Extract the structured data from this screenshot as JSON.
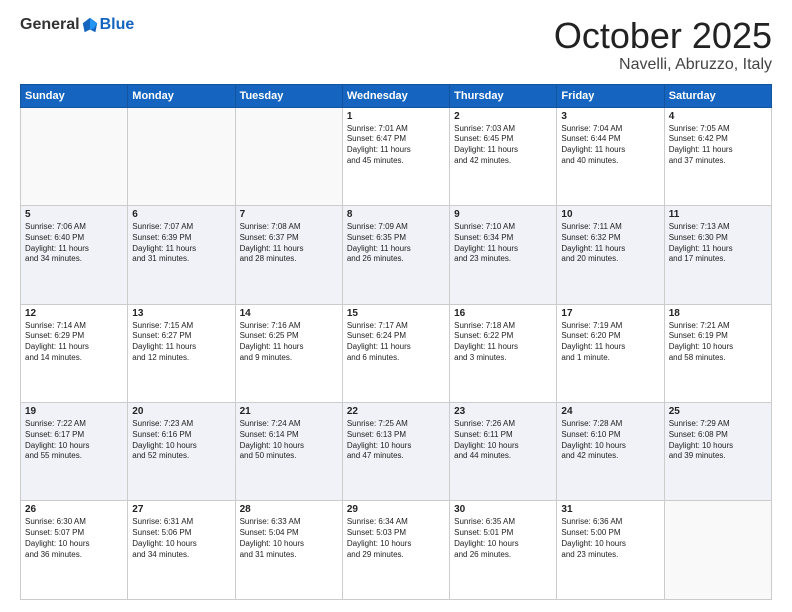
{
  "header": {
    "logo_general": "General",
    "logo_blue": "Blue",
    "title": "October 2025",
    "location": "Navelli, Abruzzo, Italy"
  },
  "weekdays": [
    "Sunday",
    "Monday",
    "Tuesday",
    "Wednesday",
    "Thursday",
    "Friday",
    "Saturday"
  ],
  "weeks": [
    {
      "bg": "norm",
      "days": [
        {
          "num": "",
          "info": ""
        },
        {
          "num": "",
          "info": ""
        },
        {
          "num": "",
          "info": ""
        },
        {
          "num": "1",
          "info": "Sunrise: 7:01 AM\nSunset: 6:47 PM\nDaylight: 11 hours\nand 45 minutes."
        },
        {
          "num": "2",
          "info": "Sunrise: 7:03 AM\nSunset: 6:45 PM\nDaylight: 11 hours\nand 42 minutes."
        },
        {
          "num": "3",
          "info": "Sunrise: 7:04 AM\nSunset: 6:44 PM\nDaylight: 11 hours\nand 40 minutes."
        },
        {
          "num": "4",
          "info": "Sunrise: 7:05 AM\nSunset: 6:42 PM\nDaylight: 11 hours\nand 37 minutes."
        }
      ]
    },
    {
      "bg": "alt",
      "days": [
        {
          "num": "5",
          "info": "Sunrise: 7:06 AM\nSunset: 6:40 PM\nDaylight: 11 hours\nand 34 minutes."
        },
        {
          "num": "6",
          "info": "Sunrise: 7:07 AM\nSunset: 6:39 PM\nDaylight: 11 hours\nand 31 minutes."
        },
        {
          "num": "7",
          "info": "Sunrise: 7:08 AM\nSunset: 6:37 PM\nDaylight: 11 hours\nand 28 minutes."
        },
        {
          "num": "8",
          "info": "Sunrise: 7:09 AM\nSunset: 6:35 PM\nDaylight: 11 hours\nand 26 minutes."
        },
        {
          "num": "9",
          "info": "Sunrise: 7:10 AM\nSunset: 6:34 PM\nDaylight: 11 hours\nand 23 minutes."
        },
        {
          "num": "10",
          "info": "Sunrise: 7:11 AM\nSunset: 6:32 PM\nDaylight: 11 hours\nand 20 minutes."
        },
        {
          "num": "11",
          "info": "Sunrise: 7:13 AM\nSunset: 6:30 PM\nDaylight: 11 hours\nand 17 minutes."
        }
      ]
    },
    {
      "bg": "norm",
      "days": [
        {
          "num": "12",
          "info": "Sunrise: 7:14 AM\nSunset: 6:29 PM\nDaylight: 11 hours\nand 14 minutes."
        },
        {
          "num": "13",
          "info": "Sunrise: 7:15 AM\nSunset: 6:27 PM\nDaylight: 11 hours\nand 12 minutes."
        },
        {
          "num": "14",
          "info": "Sunrise: 7:16 AM\nSunset: 6:25 PM\nDaylight: 11 hours\nand 9 minutes."
        },
        {
          "num": "15",
          "info": "Sunrise: 7:17 AM\nSunset: 6:24 PM\nDaylight: 11 hours\nand 6 minutes."
        },
        {
          "num": "16",
          "info": "Sunrise: 7:18 AM\nSunset: 6:22 PM\nDaylight: 11 hours\nand 3 minutes."
        },
        {
          "num": "17",
          "info": "Sunrise: 7:19 AM\nSunset: 6:20 PM\nDaylight: 11 hours\nand 1 minute."
        },
        {
          "num": "18",
          "info": "Sunrise: 7:21 AM\nSunset: 6:19 PM\nDaylight: 10 hours\nand 58 minutes."
        }
      ]
    },
    {
      "bg": "alt",
      "days": [
        {
          "num": "19",
          "info": "Sunrise: 7:22 AM\nSunset: 6:17 PM\nDaylight: 10 hours\nand 55 minutes."
        },
        {
          "num": "20",
          "info": "Sunrise: 7:23 AM\nSunset: 6:16 PM\nDaylight: 10 hours\nand 52 minutes."
        },
        {
          "num": "21",
          "info": "Sunrise: 7:24 AM\nSunset: 6:14 PM\nDaylight: 10 hours\nand 50 minutes."
        },
        {
          "num": "22",
          "info": "Sunrise: 7:25 AM\nSunset: 6:13 PM\nDaylight: 10 hours\nand 47 minutes."
        },
        {
          "num": "23",
          "info": "Sunrise: 7:26 AM\nSunset: 6:11 PM\nDaylight: 10 hours\nand 44 minutes."
        },
        {
          "num": "24",
          "info": "Sunrise: 7:28 AM\nSunset: 6:10 PM\nDaylight: 10 hours\nand 42 minutes."
        },
        {
          "num": "25",
          "info": "Sunrise: 7:29 AM\nSunset: 6:08 PM\nDaylight: 10 hours\nand 39 minutes."
        }
      ]
    },
    {
      "bg": "norm",
      "days": [
        {
          "num": "26",
          "info": "Sunrise: 6:30 AM\nSunset: 5:07 PM\nDaylight: 10 hours\nand 36 minutes."
        },
        {
          "num": "27",
          "info": "Sunrise: 6:31 AM\nSunset: 5:06 PM\nDaylight: 10 hours\nand 34 minutes."
        },
        {
          "num": "28",
          "info": "Sunrise: 6:33 AM\nSunset: 5:04 PM\nDaylight: 10 hours\nand 31 minutes."
        },
        {
          "num": "29",
          "info": "Sunrise: 6:34 AM\nSunset: 5:03 PM\nDaylight: 10 hours\nand 29 minutes."
        },
        {
          "num": "30",
          "info": "Sunrise: 6:35 AM\nSunset: 5:01 PM\nDaylight: 10 hours\nand 26 minutes."
        },
        {
          "num": "31",
          "info": "Sunrise: 6:36 AM\nSunset: 5:00 PM\nDaylight: 10 hours\nand 23 minutes."
        },
        {
          "num": "",
          "info": ""
        }
      ]
    }
  ]
}
